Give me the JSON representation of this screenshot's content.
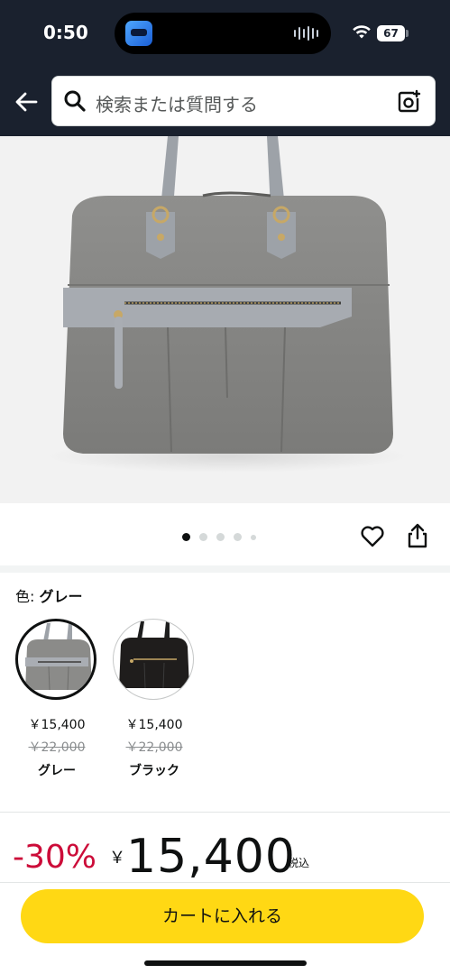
{
  "status_bar": {
    "time": "0:50",
    "battery": "67"
  },
  "search": {
    "placeholder": "検索または質問する"
  },
  "icons": {
    "back": "back-arrow-icon",
    "search": "search-icon",
    "camera": "camera-lens-icon",
    "favorite": "heart-icon",
    "share": "share-icon"
  },
  "image_carousel": {
    "dot_count": 5,
    "active_index": 0
  },
  "color_selector": {
    "label": "色:",
    "selected_value": "グレー",
    "options": [
      {
        "price": "￥15,400",
        "list_price": "￥22,000",
        "name": "グレー",
        "selected": true
      },
      {
        "price": "￥15,400",
        "list_price": "￥22,000",
        "name": "ブラック",
        "selected": false
      }
    ]
  },
  "pricing": {
    "discount": "-30%",
    "currency": "￥",
    "price": "15,400",
    "tax_note": "税込"
  },
  "cta": {
    "label": "カートに入れる"
  },
  "colors": {
    "header_bg": "#1a212e",
    "cta_bg": "#ffd814",
    "discount_red": "#cc0c39",
    "bag_gray": "#8b8b89"
  }
}
